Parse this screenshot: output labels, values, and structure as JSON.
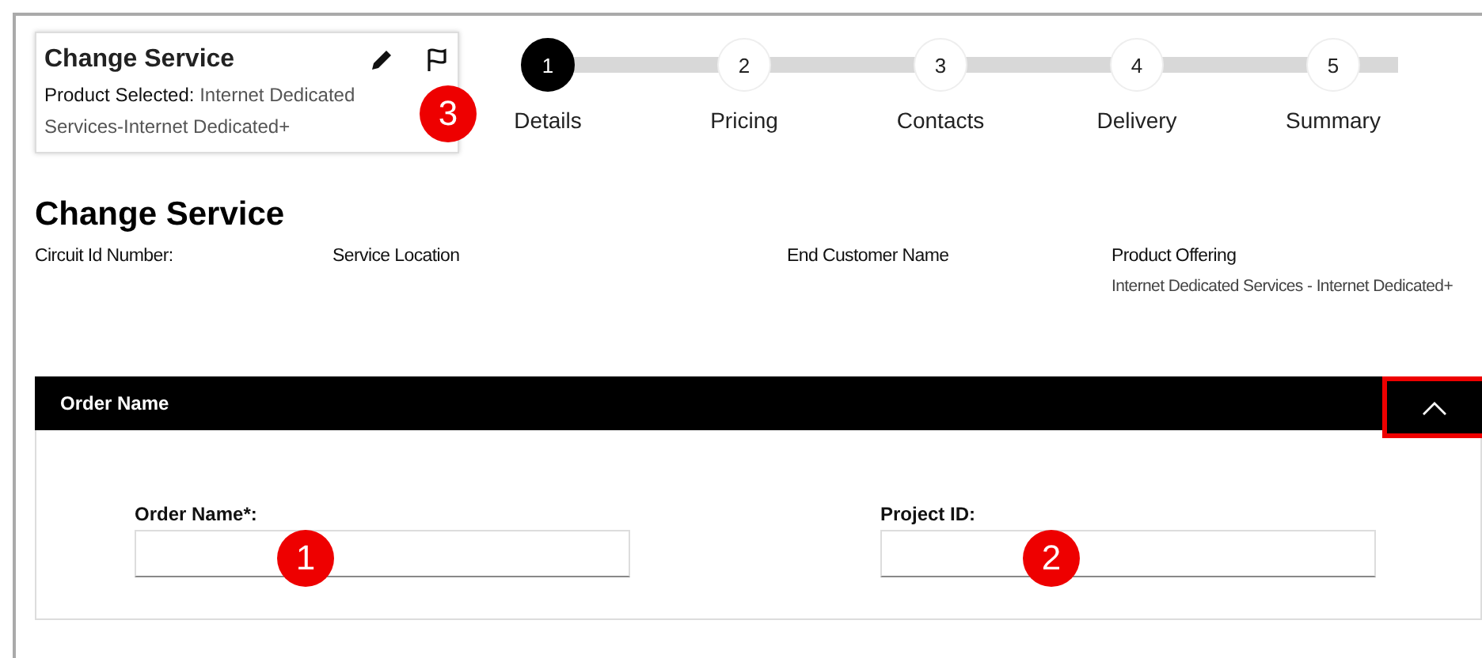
{
  "summary_card": {
    "title": "Change Service",
    "product_label": "Product Selected:",
    "product_value": "Internet Dedicated Services-Internet Dedicated+"
  },
  "steps": [
    {
      "number": "1",
      "label": "Details",
      "selected": true
    },
    {
      "number": "2",
      "label": "Pricing",
      "selected": false
    },
    {
      "number": "3",
      "label": "Contacts",
      "selected": false
    },
    {
      "number": "4",
      "label": "Delivery",
      "selected": false
    },
    {
      "number": "5",
      "label": "Summary",
      "selected": false
    }
  ],
  "page_title": "Change Service",
  "info_fields": [
    {
      "label": "Circuit Id Number:"
    },
    {
      "label": "Service Location"
    },
    {
      "label": "End Customer Name"
    },
    {
      "label": "Product Offering",
      "value": "Internet Dedicated Services - Internet Dedicated+"
    }
  ],
  "section": {
    "title": "Order Name",
    "expanded": true,
    "fields": [
      {
        "label": "Order Name*:"
      },
      {
        "label": "Project ID:"
      }
    ]
  },
  "callouts": [
    "3",
    "1",
    "2"
  ]
}
